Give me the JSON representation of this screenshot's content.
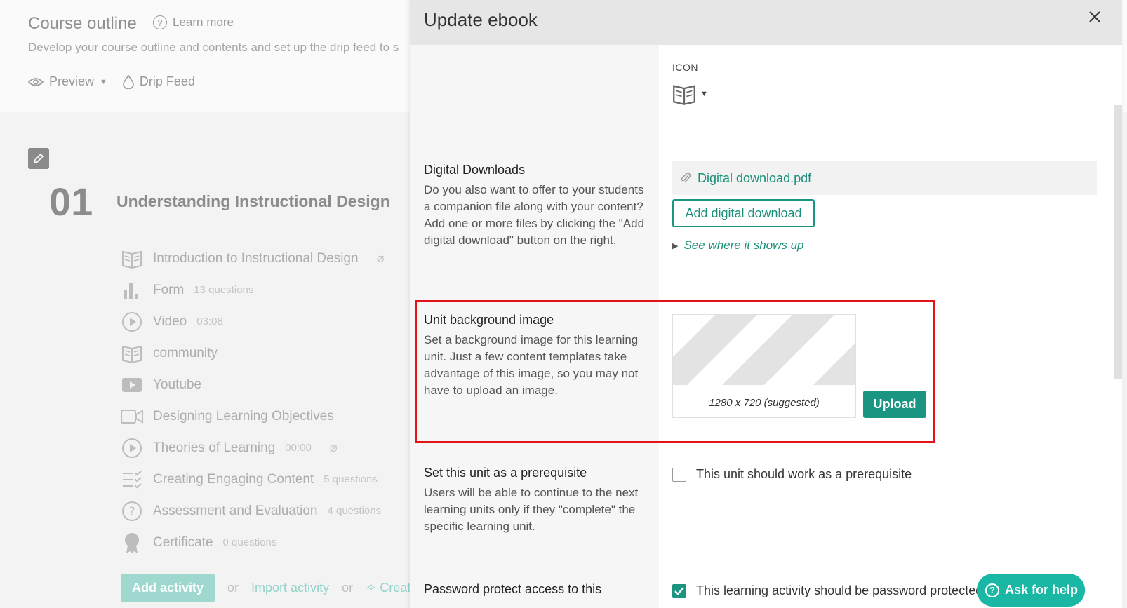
{
  "background": {
    "title": "Course outline",
    "learn_more": "Learn more",
    "subtitle": "Develop your course outline and contents and set up the drip feed to s",
    "preview": "Preview",
    "drip_feed": "Drip Feed",
    "unit_number": "01",
    "unit_title": "Understanding Instructional Design",
    "activities": [
      {
        "icon": "book-icon",
        "name": "Introduction to Instructional Design",
        "meta": "",
        "attachment": true
      },
      {
        "icon": "bar-chart-icon",
        "name": "Form",
        "meta": "13 questions",
        "attachment": false
      },
      {
        "icon": "play-circle-icon",
        "name": "Video",
        "meta": "03:08",
        "attachment": false
      },
      {
        "icon": "book-icon",
        "name": "community",
        "meta": "",
        "attachment": false
      },
      {
        "icon": "youtube-icon",
        "name": "Youtube",
        "meta": "",
        "attachment": false
      },
      {
        "icon": "video-camera-icon",
        "name": "Designing Learning Objectives",
        "meta": "",
        "attachment": false
      },
      {
        "icon": "play-circle-icon",
        "name": "Theories of Learning",
        "meta": "00:00",
        "attachment": true
      },
      {
        "icon": "checklist-icon",
        "name": "Creating Engaging Content",
        "meta": "5 questions",
        "attachment": false
      },
      {
        "icon": "question-circle-icon",
        "name": "Assessment and Evaluation",
        "meta": "4 questions",
        "attachment": false
      },
      {
        "icon": "certificate-icon",
        "name": "Certificate",
        "meta": "0 questions",
        "attachment": false
      }
    ],
    "add_activity": "Add activity",
    "or1": "or",
    "import_activity": "Import activity",
    "or2": "or",
    "create": "Creat"
  },
  "modal": {
    "title": "Update ebook",
    "icon_label": "ICON",
    "digital_downloads": {
      "heading": "Digital Downloads",
      "description": "Do you also want to offer to your students a companion file along with your content? Add one or more files by clicking the \"Add digital download\" button on the right.",
      "file_name": "Digital download.pdf",
      "add_button": "Add digital download",
      "see_where": "See where it shows up"
    },
    "background_image": {
      "heading": "Unit background image",
      "description": "Set a background image for this learning unit. Just a few content templates take advantage of this image, so you may not have to upload an image.",
      "caption": "1280 x 720 (suggested)",
      "upload_button": "Upload"
    },
    "prerequisite": {
      "heading": "Set this unit as a prerequisite",
      "description": "Users will be able to continue to the next learning units only if they \"complete\" the specific learning unit.",
      "checkbox_label": "This unit should work as a prerequisite",
      "checked": false
    },
    "password": {
      "heading": "Password protect access to this",
      "checkbox_label": "This learning activity should be password protected",
      "checked": true
    }
  },
  "help": {
    "label": "Ask for help"
  },
  "colors": {
    "accent": "#1a9582",
    "highlight": "#e3121b",
    "help": "#1ab7a4"
  }
}
